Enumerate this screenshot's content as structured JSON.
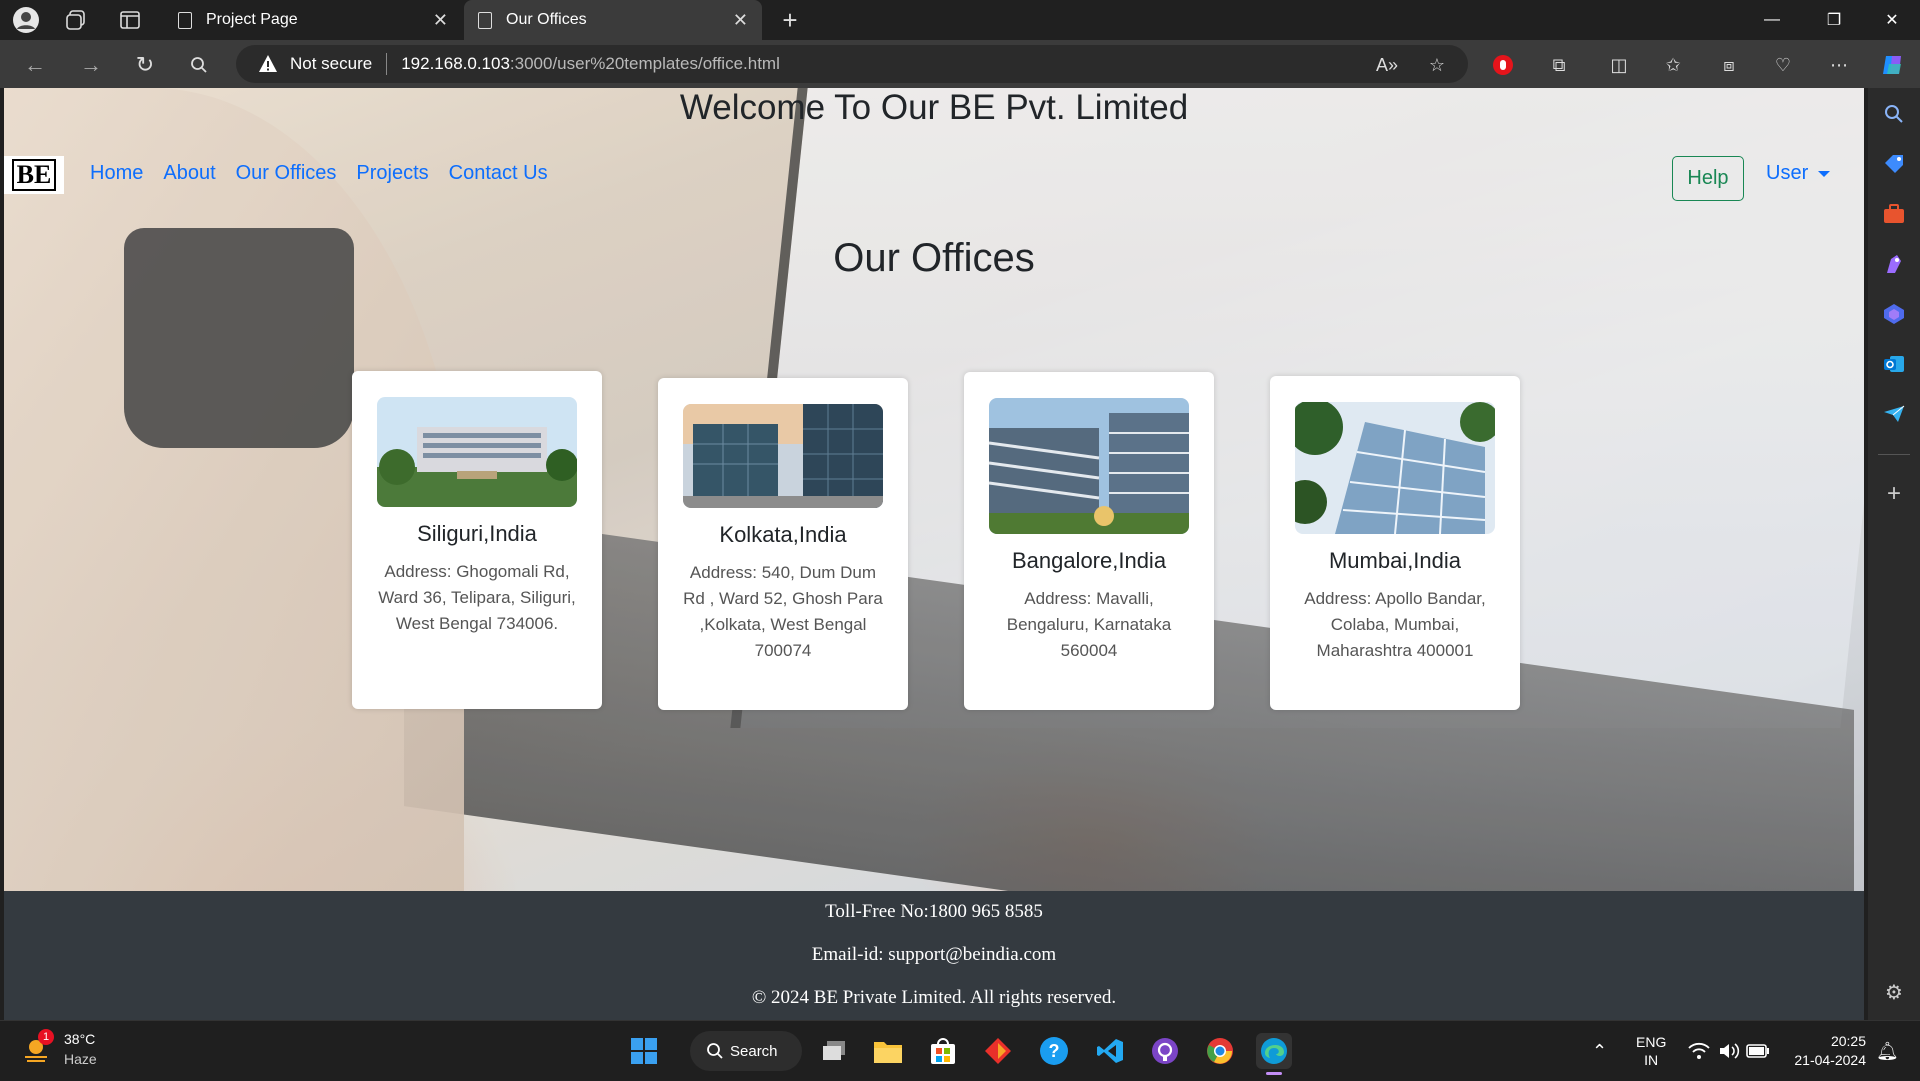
{
  "browser": {
    "tabs": [
      {
        "title": "Project Page"
      },
      {
        "title": "Our Offices"
      }
    ],
    "address": {
      "security": "Not secure",
      "host": "192.168.0.103",
      "path": ":3000/user%20templates/office.html"
    }
  },
  "page": {
    "welcome": "Welcome To Our BE Pvt. Limited",
    "logo": "BE",
    "nav": [
      "Home",
      "About",
      "Our Offices",
      "Projects",
      "Contact Us"
    ],
    "help": "Help",
    "user": "User",
    "section_title": "Our Offices",
    "offices": [
      {
        "city": "Siliguri,India",
        "address": "Address: Ghogomali Rd, Ward 36, Telipara, Siliguri, West Bengal 734006."
      },
      {
        "city": "Kolkata,India",
        "address": "Address: 540, Dum Dum Rd , Ward 52, Ghosh Para ,Kolkata, West Bengal 700074"
      },
      {
        "city": "Bangalore,India",
        "address": "Address: Mavalli, Bengaluru, Karnataka 560004"
      },
      {
        "city": "Mumbai,India",
        "address": "Address: Apollo Bandar, Colaba, Mumbai, Maharashtra 400001"
      }
    ],
    "footer": {
      "tollfree": "Toll-Free No:1800 965 8585",
      "email": "Email-id: support@beindia.com",
      "copyright": "© 2024 BE Private Limited. All rights reserved."
    }
  },
  "taskbar": {
    "weather_temp": "38°C",
    "weather_desc": "Haze",
    "weather_badge": "1",
    "search": "Search",
    "lang_top": "ENG",
    "lang_bottom": "IN",
    "time": "20:25",
    "date": "21-04-2024"
  }
}
